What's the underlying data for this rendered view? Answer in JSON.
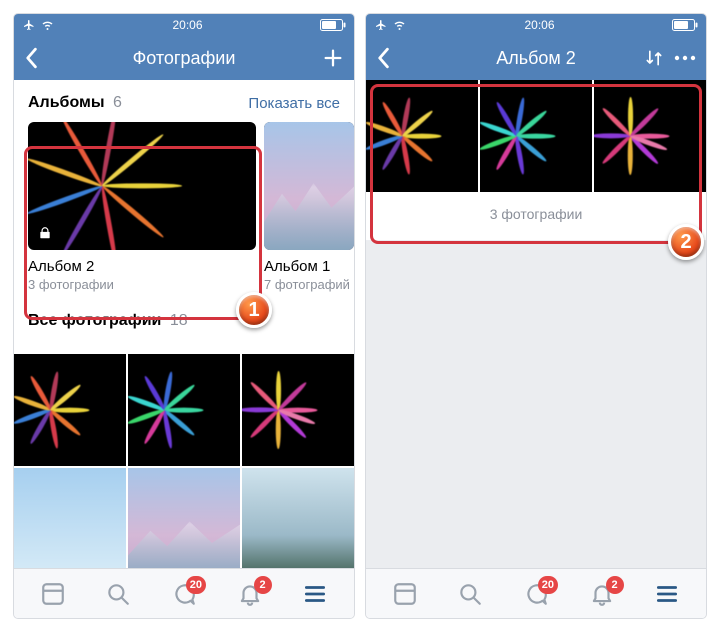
{
  "status": {
    "time": "20:06"
  },
  "phone1": {
    "nav_title": "Фотографии",
    "albums_section": {
      "title": "Альбомы",
      "count": "6",
      "show_all": "Показать все"
    },
    "album_main": {
      "name": "Альбом 2",
      "subtitle": "3 фотографии"
    },
    "album_secondary": {
      "name": "Альбом 1",
      "subtitle": "7 фотографий"
    },
    "all_photos": {
      "title": "Все фотографии",
      "count": "18"
    }
  },
  "phone2": {
    "nav_title": "Альбом 2",
    "count_text": "3 фотографии"
  },
  "tabbar": {
    "badge_msg": "20",
    "badge_notif": "2"
  },
  "callouts": {
    "one": "1",
    "two": "2"
  }
}
